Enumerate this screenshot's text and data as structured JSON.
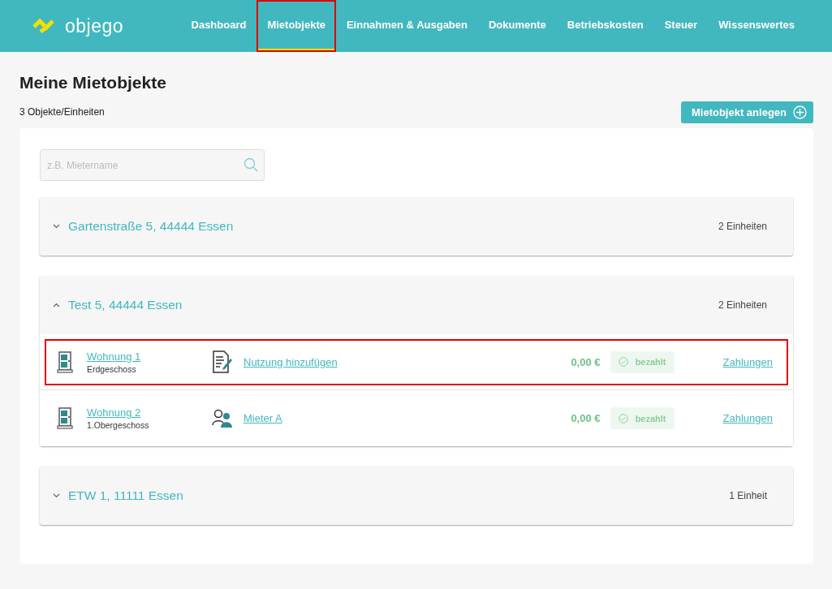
{
  "header": {
    "logo": "objego",
    "nav": [
      {
        "label": "Dashboard",
        "selected": false,
        "highlighted": false
      },
      {
        "label": "Mietobjekte",
        "selected": true,
        "highlighted": true
      },
      {
        "label": "Einnahmen & Ausgaben",
        "selected": false,
        "highlighted": false
      },
      {
        "label": "Dokumente",
        "selected": false,
        "highlighted": false
      },
      {
        "label": "Betriebskosten",
        "selected": false,
        "highlighted": false
      },
      {
        "label": "Steuer",
        "selected": false,
        "highlighted": false
      },
      {
        "label": "Wissenswertes",
        "selected": false,
        "highlighted": false
      }
    ]
  },
  "page": {
    "title": "Meine Mietobjekte",
    "subtitle": "3 Objekte/Einheiten",
    "add_button": "Mietobjekt anlegen"
  },
  "search": {
    "placeholder": "z.B. Mietername"
  },
  "properties": [
    {
      "address": "Gartenstraße 5, 44444 Essen",
      "units_count": "2 Einheiten",
      "expanded": false
    },
    {
      "address": "Test 5, 44444 Essen",
      "units_count": "2 Einheiten",
      "expanded": true,
      "units": [
        {
          "name": "Wohnung 1",
          "floor": "Erdgeschoss",
          "kind": "add_usage",
          "usage": "Nutzung hinzufügen",
          "amount": "0,00 €",
          "status": "bezahlt",
          "payments": "Zahlungen",
          "highlighted": true
        },
        {
          "name": "Wohnung 2",
          "floor": "1.Obergeschoss",
          "kind": "tenant",
          "usage": "Mieter A",
          "amount": "0,00 €",
          "status": "bezahlt",
          "payments": "Zahlungen",
          "highlighted": false
        }
      ]
    },
    {
      "address": "ETW 1, 11111 Essen",
      "units_count": "1 Einheit",
      "expanded": false
    }
  ]
}
